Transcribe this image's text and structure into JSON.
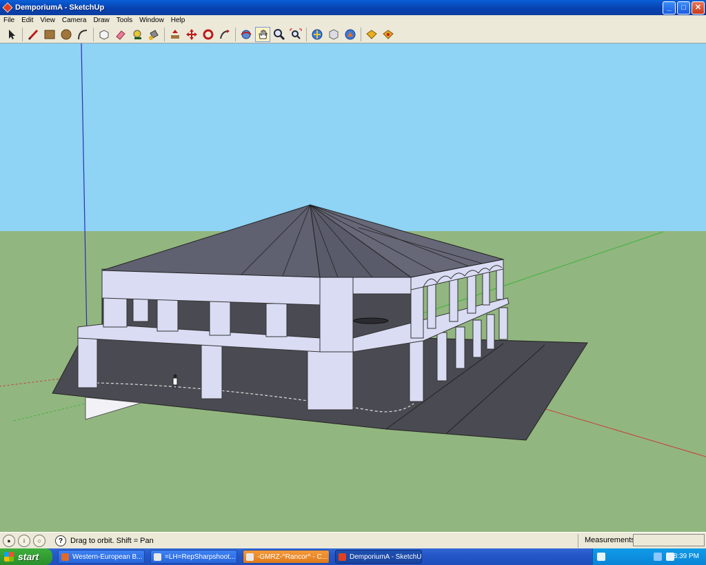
{
  "window": {
    "title": "DemporiumA - SketchUp"
  },
  "window_buttons": {
    "minimize": "_",
    "maximize": "□",
    "close": "✕"
  },
  "menu": [
    "File",
    "Edit",
    "View",
    "Camera",
    "Draw",
    "Tools",
    "Window",
    "Help"
  ],
  "toolbar": {
    "tools": [
      "select-tool",
      "line-tool",
      "rectangle-tool",
      "circle-tool",
      "arc-tool",
      "make-component-tool",
      "eraser-tool",
      "tape-measure-tool",
      "paint-bucket-tool",
      "push-pull-tool",
      "move-tool",
      "rotate-tool",
      "follow-me-tool",
      "orbit-tool",
      "pan-tool",
      "zoom-tool",
      "zoom-extents-tool",
      "get-models-tool",
      "share-model-tool",
      "share-component-tool",
      "ruby-tool",
      "photo-match-tool"
    ],
    "active_tool": "pan-tool"
  },
  "status": {
    "text": "Drag to orbit.  Shift = Pan",
    "measurements_label": "Measurements",
    "measurements_value": ""
  },
  "taskbar": {
    "start_label": "start",
    "tasks": [
      {
        "label": "Western-European B...",
        "active": false
      },
      {
        "label": "=LH=RepSharpshoot...",
        "active": false
      },
      {
        "label": "-GMRZ-^Rancor^ - C...",
        "active": false
      },
      {
        "label": "DemporiumA - SketchUp",
        "active": true
      }
    ],
    "clock": "8:39 PM"
  },
  "colors": {
    "sky": "#8ed2f4",
    "ground": "#90b47e",
    "roof": "#5f6070",
    "walls": "#dadcf4",
    "floor": "#4a4a52",
    "axis_red": "#c83c3c",
    "axis_green": "#3cb43c",
    "axis_blue": "#2c2cb4"
  }
}
